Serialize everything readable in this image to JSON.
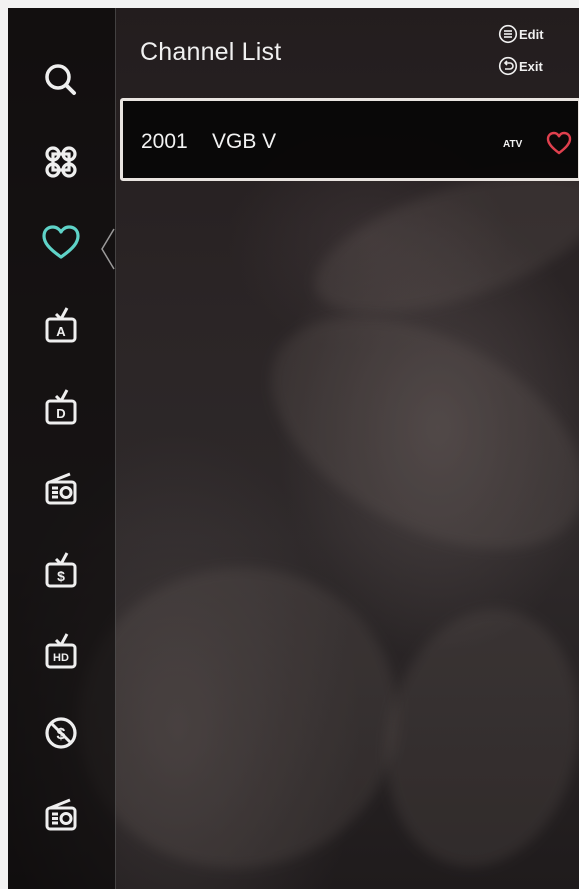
{
  "header": {
    "title": "Channel List"
  },
  "hints": [
    {
      "icon": "menu-icon",
      "label": "Edit"
    },
    {
      "icon": "return-icon",
      "label": "Exit"
    }
  ],
  "sidebar": {
    "items": [
      {
        "name": "search",
        "icon": "search-icon"
      },
      {
        "name": "all-channels",
        "icon": "command-icon"
      },
      {
        "name": "favorites",
        "icon": "heart-icon",
        "selected": true
      },
      {
        "name": "analog-tv",
        "icon": "tv-a-icon"
      },
      {
        "name": "digital-tv",
        "icon": "tv-d-icon"
      },
      {
        "name": "radio",
        "icon": "radio-icon"
      },
      {
        "name": "pay-tv",
        "icon": "tv-dollar-icon"
      },
      {
        "name": "hd-tv",
        "icon": "tv-hd-icon"
      },
      {
        "name": "free-channels",
        "icon": "no-dollar-icon"
      },
      {
        "name": "radio-2",
        "icon": "radio-icon"
      }
    ]
  },
  "channels": [
    {
      "number": "2001",
      "name": "VGB V",
      "type": "ATV",
      "favorite": true
    }
  ],
  "colors": {
    "accent_selected": "#5fd3c8",
    "favorite_heart": "#e0404e",
    "icon": "#efefef"
  }
}
